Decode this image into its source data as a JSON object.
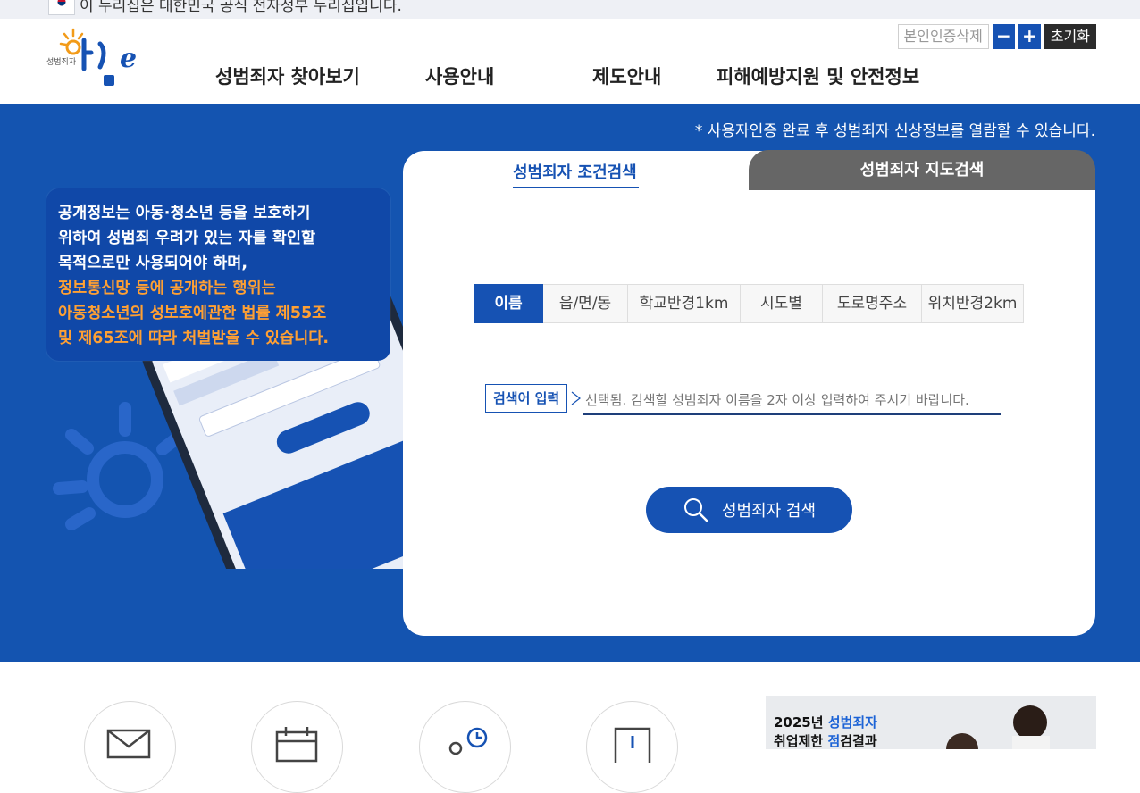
{
  "gov_banner": {
    "text": "이 누리집은 대한민국 공식 전자정부 누리집입니다."
  },
  "header": {
    "logo_small": "성범죄자",
    "nav": [
      "성범죄자 찾아보기",
      "사용안내",
      "제도안내",
      "피해예방지원 및 안전정보"
    ],
    "util": {
      "reset_cert": "본인인증삭제",
      "minus": "−",
      "plus": "+",
      "init": "초기화"
    }
  },
  "hero": {
    "notice": "* 사용자인증 완료 후 성범죄자 신상정보를 열람할 수 있습니다.",
    "info_lines_white": [
      "공개정보는 아동·청소년 등을 보호하기",
      "위하여 성범죄 우려가 있는 자를 확인할",
      "목적으로만 사용되어야 하며,"
    ],
    "info_lines_orange": [
      "정보통신망 등에 공개하는 행위는",
      "아동청소년의 성보호에관한 법률 제55조",
      "및 제65조에 따라 처벌받을 수 있습니다."
    ]
  },
  "search": {
    "tabs": [
      "성범죄자 조건검색",
      "성범죄자 지도검색"
    ],
    "subtabs": [
      "이름",
      "읍/면/동",
      "학교반경1km",
      "시도별",
      "도로명주소",
      "위치반경2km"
    ],
    "keyword_label": "검색어 입력",
    "keyword_placeholder": "선택됨. 검색할 성범죄자 이름을 2자 이상 입력하여 주시기 바랍니다.",
    "button": "성범죄자 검색"
  },
  "bottom_banner": {
    "year_text": "2025년 ",
    "highlight1": "성범죄자",
    "line2_a": "취업제한 ",
    "highlight2": "점",
    "line2_b": "검결과"
  },
  "colors": {
    "primary": "#1454b0",
    "accent_orange": "#ffa033",
    "tab_inactive": "#666666"
  }
}
